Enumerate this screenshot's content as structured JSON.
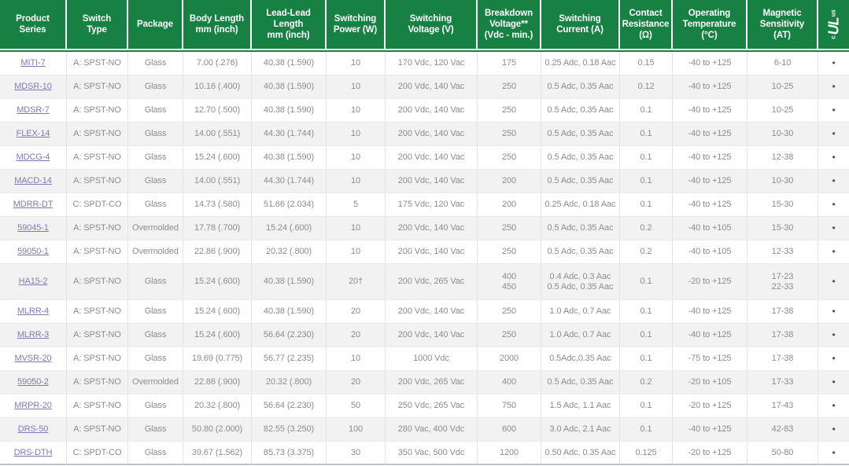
{
  "colors": {
    "header_green": "#178143",
    "body_text": "#8c8c8c",
    "stripe": "#f2f2f2",
    "separator": "#e4e4e4",
    "separator_h": "#ebebeb",
    "bottom_edge": "#bdc1c4",
    "link_purple": "#8279b1"
  },
  "table": {
    "headers": [
      "Product\nSeries",
      "Switch\nType",
      "Package",
      "Body Length\nmm (inch)",
      "Lead-Lead\nLength\nmm (inch)",
      "Switching\nPower (W)",
      "Switching\nVoltage (V)",
      "Breakdown\nVoltage**\n(Vdc - min.)",
      "Switching\nCurrent (A)",
      "Contact\nResistance\n(Ω)",
      "Operating\nTemperature\n(°C)",
      "Magnetic\nSensitivity\n(AT)"
    ],
    "ul_mark": {
      "c": "c",
      "ul": "UL",
      "us": "us"
    },
    "rows": [
      {
        "series": "MITI-7",
        "switch_type": "A: SPST-NO",
        "package": "Glass",
        "body_length": "7.00 (.276)",
        "lead_length": "40.38 (1.590)",
        "power": "10",
        "voltage": "170 Vdc, 120 Vac",
        "breakdown": "175",
        "current": "0.25 Adc, 0.18 Aac",
        "resistance": "0.15",
        "temperature": "-40 to +125",
        "sensitivity": "6-10",
        "ul": "•"
      },
      {
        "series": "MDSR-10",
        "switch_type": "A: SPST-NO",
        "package": "Glass",
        "body_length": "10.16 (.400)",
        "lead_length": "40.38 (1.590)",
        "power": "10",
        "voltage": "200 Vdc, 140 Vac",
        "breakdown": "250",
        "current": "0.5 Adc, 0.35 Aac",
        "resistance": "0.12",
        "temperature": "-40 to +125",
        "sensitivity": "10-25",
        "ul": "•"
      },
      {
        "series": "MDSR-7",
        "switch_type": "A: SPST-NO",
        "package": "Glass",
        "body_length": "12.70 (.500)",
        "lead_length": "40.38 (1.590)",
        "power": "10",
        "voltage": "200 Vdc, 140 Vac",
        "breakdown": "250",
        "current": "0.5 Adc, 0.35 Aac",
        "resistance": "0.1",
        "temperature": "-40 to +125",
        "sensitivity": "10-25",
        "ul": "•"
      },
      {
        "series": "FLEX-14",
        "switch_type": "A: SPST-NO",
        "package": "Glass",
        "body_length": "14.00 (.551)",
        "lead_length": "44.30 (1.744)",
        "power": "10",
        "voltage": "200 Vdc, 140 Vac",
        "breakdown": "250",
        "current": "0.5 Adc, 0.35 Aac",
        "resistance": "0.1",
        "temperature": "-40 to +125",
        "sensitivity": "10-30",
        "ul": "•"
      },
      {
        "series": "MDCG-4",
        "switch_type": "A: SPST-NO",
        "package": "Glass",
        "body_length": "15.24 (.600)",
        "lead_length": "40.38 (1.590)",
        "power": "10",
        "voltage": "200 Vdc, 140 Vac",
        "breakdown": "250",
        "current": "0.5 Adc, 0.35 Aac",
        "resistance": "0.1",
        "temperature": "-40 to +125",
        "sensitivity": "12-38",
        "ul": "•"
      },
      {
        "series": "MACD-14",
        "switch_type": "A: SPST-NO",
        "package": "Glass",
        "body_length": "14.00 (.551)",
        "lead_length": "44.30 (1.744)",
        "power": "10",
        "voltage": "200 Vdc, 140 Vac",
        "breakdown": "200",
        "current": "0.5 Adc, 0.35 Aac",
        "resistance": "0.1",
        "temperature": "-40 to +125",
        "sensitivity": "10-30",
        "ul": "•"
      },
      {
        "series": "MDRR-DT",
        "switch_type": "C: SPDT-CO",
        "package": "Glass",
        "body_length": "14.73 (.580)",
        "lead_length": "51.66 (2.034)",
        "power": "5",
        "voltage": "175 Vdc, 120 Vac",
        "breakdown": "200",
        "current": "0.25 Adc, 0.18 Aac",
        "resistance": "0.1",
        "temperature": "-40 to +125",
        "sensitivity": "15-30",
        "ul": "•"
      },
      {
        "series": "59045-1",
        "switch_type": "A: SPST-NO",
        "package": "Overmolded",
        "body_length": "17.78 (.700)",
        "lead_length": "15.24 (.600)",
        "power": "10",
        "voltage": "200 Vdc, 140 Vac",
        "breakdown": "250",
        "current": "0.5 Adc, 0.35 Aac",
        "resistance": "0.2",
        "temperature": "-40 to +105",
        "sensitivity": "15-30",
        "ul": "•"
      },
      {
        "series": "59050-1",
        "switch_type": "A: SPST-NO",
        "package": "Overmolded",
        "body_length": "22.86 (.900)",
        "lead_length": "20.32 (.800)",
        "power": "10",
        "voltage": "200 Vdc, 140 Vac",
        "breakdown": "250",
        "current": "0.5 Adc, 0.35 Aac",
        "resistance": "0.2",
        "temperature": "-40 to +105",
        "sensitivity": "12-33",
        "ul": "•"
      },
      {
        "series": "HA15-2",
        "switch_type": "A: SPST-NO",
        "package": "Glass",
        "body_length": "15.24 (.600)",
        "lead_length": "40.38 (1.590)",
        "power": "20†",
        "voltage": "200 Vdc, 265 Vac",
        "breakdown": "400\n450",
        "current": "0.4 Adc, 0.3 Aac\n0.5 Adc, 0.35 Aac",
        "resistance": "0.1",
        "temperature": "-20 to +125",
        "sensitivity": "17-23\n22-33",
        "ul": "•"
      },
      {
        "series": "MLRR-4",
        "switch_type": "A: SPST-NO",
        "package": "Glass",
        "body_length": "15.24 (.600)",
        "lead_length": "40.38 (1.590)",
        "power": "20",
        "voltage": "200 Vdc, 140 Vac",
        "breakdown": "250",
        "current": "1.0 Adc, 0.7 Aac",
        "resistance": "0.1",
        "temperature": "-40 to +125",
        "sensitivity": "17-38",
        "ul": "•"
      },
      {
        "series": "MLRR-3",
        "switch_type": "A: SPST-NO",
        "package": "Glass",
        "body_length": "15.24 (.600)",
        "lead_length": "56.64 (2.230)",
        "power": "20",
        "voltage": "200 Vdc, 140 Vac",
        "breakdown": "250",
        "current": "1.0 Adc, 0.7 Aac",
        "resistance": "0.1",
        "temperature": "-40 to +125",
        "sensitivity": "17-38",
        "ul": "•"
      },
      {
        "series": "MVSR-20",
        "switch_type": "A: SPST-NO",
        "package": "Glass",
        "body_length": "19.69 (0.775)",
        "lead_length": "56.77 (2.235)",
        "power": "10",
        "voltage": "1000 Vdc",
        "breakdown": "2000",
        "current": "0.5Adc,0.35 Aac",
        "resistance": "0.1",
        "temperature": "-75 to +125",
        "sensitivity": "17-38",
        "ul": "•"
      },
      {
        "series": "59050-2",
        "switch_type": "A: SPST-NO",
        "package": "Overmolded",
        "body_length": "22.86 (.900)",
        "lead_length": "20.32 (.800)",
        "power": "20",
        "voltage": "200 Vdc, 265 Vac",
        "breakdown": "400",
        "current": "0.5 Adc, 0.35 Aac",
        "resistance": "0.2",
        "temperature": "-20 to +105",
        "sensitivity": "17-33",
        "ul": "•"
      },
      {
        "series": "MRPR-20",
        "switch_type": "A: SPST-NO",
        "package": "Glass",
        "body_length": "20.32 (.800)",
        "lead_length": "56.64 (2.230)",
        "power": "50",
        "voltage": "250 Vdc, 265 Vac",
        "breakdown": "750",
        "current": "1.5 Adc, 1.1 Aac",
        "resistance": "0.1",
        "temperature": "-20 to +125",
        "sensitivity": "17-43",
        "ul": "•"
      },
      {
        "series": "DRS-50",
        "switch_type": "A: SPST-NO",
        "package": "Glass",
        "body_length": "50.80 (2.000)",
        "lead_length": "82.55 (3.250)",
        "power": "100",
        "voltage": "280 Vac, 400 Vdc",
        "breakdown": "600",
        "current": "3.0 Adc, 2.1 Aac",
        "resistance": "0.1",
        "temperature": "-40 to +125",
        "sensitivity": "42-83",
        "ul": "•"
      },
      {
        "series": "DRS-DTH",
        "switch_type": "C: SPDT-CO",
        "package": "Glass",
        "body_length": "39.67 (1.562)",
        "lead_length": "85.73 (3.375)",
        "power": "30",
        "voltage": "350 Vac, 500 Vdc",
        "breakdown": "1200",
        "current": "0.50 Adc, 0.35 Aac",
        "resistance": "0.125",
        "temperature": "-20 to +125",
        "sensitivity": "50-80",
        "ul": "•"
      }
    ]
  }
}
